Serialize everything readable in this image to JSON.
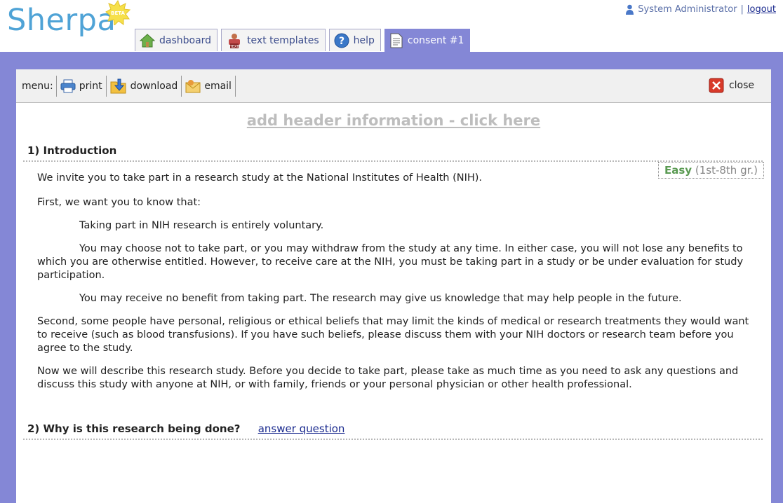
{
  "app": {
    "logo_text": "Sherpa",
    "beta_badge": "BETA"
  },
  "user": {
    "name": "System Administrator",
    "separator": "|",
    "logout_label": "logout"
  },
  "tabs": [
    {
      "label": "dashboard",
      "icon": "home-icon",
      "active": false
    },
    {
      "label": "text templates",
      "icon": "text-template-icon",
      "active": false
    },
    {
      "label": "help",
      "icon": "help-icon",
      "active": false
    },
    {
      "label": "consent #1",
      "icon": "document-icon",
      "active": true
    }
  ],
  "menu": {
    "label": "menu:",
    "print_label": "print",
    "download_label": "download",
    "email_label": "email",
    "close_label": "close"
  },
  "document": {
    "add_header_label": "add header information - click here",
    "readability": {
      "level": "Easy",
      "grade": "(1st-8th gr.)"
    },
    "sections": [
      {
        "title": "1)  Introduction",
        "paragraphs": [
          "We invite you to take part in a research study at the National Institutes of Health (NIH).",
          "First, we want you to know that:",
          "Taking part in NIH research is entirely voluntary.",
          "You may choose not to take part, or you may withdraw from the study at any time.  In either case, you will not lose any benefits to which you are otherwise entitled.  However, to receive care at the NIH, you must be taking part in a study or be under evaluation for study participation.",
          "You may receive no benefit from taking part.  The research may give us knowledge that may help people in the future.",
          "Second, some people have personal, religious or ethical beliefs that may limit the kinds of medical or research treatments they would want to receive (such as blood transfusions).  If you have such beliefs, please discuss them with your NIH doctors or research team before you agree to the study.",
          "Now we will describe this research study.  Before you decide to take part, please take as much time as you need to ask any questions and discuss this study with anyone at NIH, or with family, friends or your personal physician or other health professional."
        ]
      },
      {
        "title": "2)  Why is this research being done?",
        "answer_label": "answer question"
      }
    ]
  },
  "colors": {
    "frame": "#8487d6",
    "logo": "#4fa3d6",
    "link": "#1b2b8f",
    "easy": "#5a9a52"
  }
}
